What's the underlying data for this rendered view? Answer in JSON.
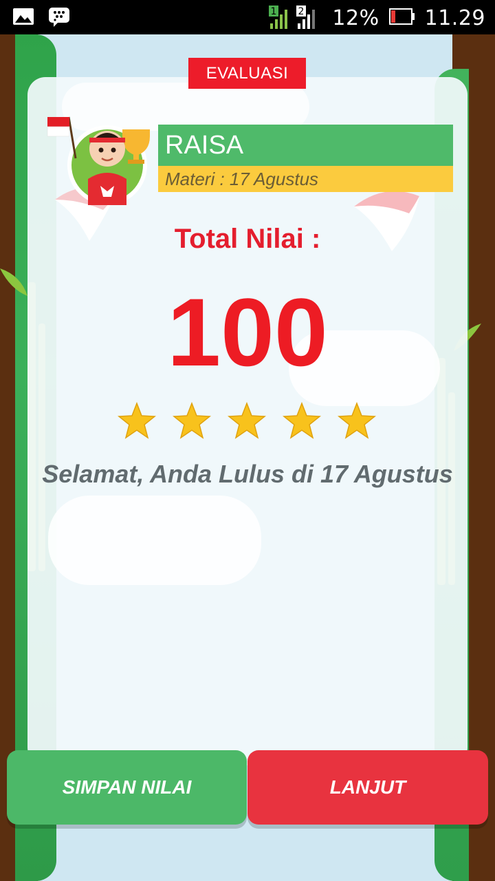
{
  "status_bar": {
    "battery_percent": "12%",
    "time": "11.29",
    "sim1_label": "1",
    "sim2_label": "2",
    "icons": [
      "gallery-icon",
      "bbm-icon",
      "signal-icon",
      "battery-icon"
    ]
  },
  "header": {
    "badge": "EVALUASI"
  },
  "player": {
    "name": "RAISA",
    "materi": "Materi : 17 Agustus"
  },
  "result": {
    "total_label": "Total Nilai :",
    "score": "100",
    "stars": 5,
    "stars_max": 5,
    "message": "Selamat, Anda Lulus di 17 Agustus"
  },
  "buttons": {
    "save": "SIMPAN NILAI",
    "next": "LANJUT"
  },
  "colors": {
    "red": "#ed1c24",
    "green": "#4fba6a",
    "yellow": "#fbcb3e",
    "button_green": "#4cb868",
    "button_red": "#e8333f"
  }
}
